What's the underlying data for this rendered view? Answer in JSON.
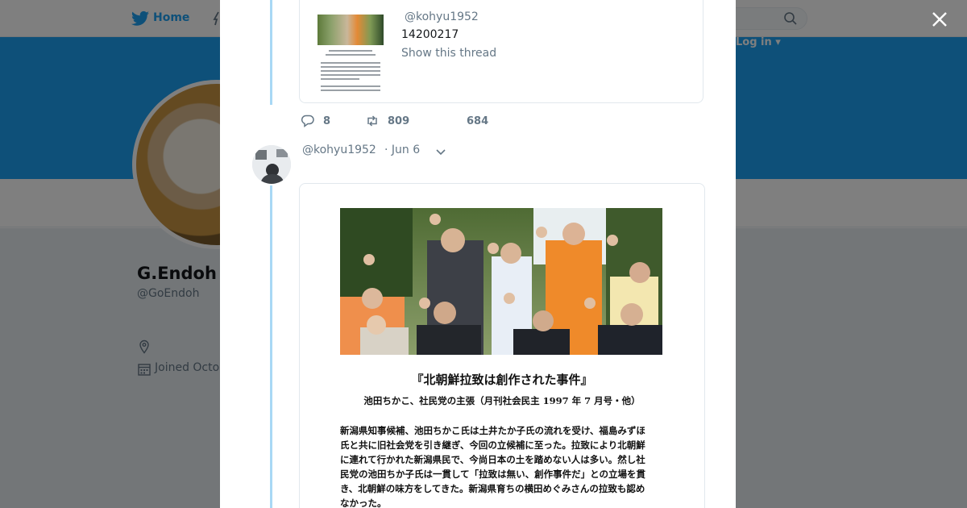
{
  "background": {
    "nav": {
      "home_label": "Home",
      "login_label": "Log in ▾"
    },
    "profile": {
      "name": "G.Endoh",
      "handle": "@GoEndoh",
      "joined": "Joined Octo"
    }
  },
  "quoted_tweet": {
    "handle": "@kohyu1952",
    "text": "14200217",
    "show_thread": "Show this thread"
  },
  "actions": {
    "replies": "8",
    "retweets": "809",
    "likes": "684"
  },
  "tweet": {
    "handle": "@kohyu1952",
    "date": "· Jun 6"
  },
  "document": {
    "title": "『北朝鮮拉致は創作された事件』",
    "subtitle": "池田ちかこ、社民党の主張（月刊社会民主 1997 年 7 月号・他）",
    "body_lines": [
      "新潟県知事候補、池田ちかこ氏は土井たか子氏の流れを受け、福島みずほ",
      "氏と共に旧社会党を引き継ぎ、今回の立候補に至った。拉致により北朝鮮",
      "に連れて行かれた新潟県民で、今尚日本の土を踏めない人は多い。然し社",
      "民党の池田ちか子氏は一貫して「拉致は無い、創作事件だ」との立場を貫",
      "き、北朝鮮の味方をしてきた。新潟県育ちの横田めぐみさんの拉致も認め",
      "なかった。"
    ]
  },
  "colors": {
    "brand": "#1da1f2",
    "thread_line": "#a8d8f5",
    "muted_text": "#657786",
    "overlay": "rgba(0,0,0,0.5)"
  },
  "icons": [
    "twitter-bird-icon",
    "moments-icon",
    "search-icon",
    "close-icon",
    "reply-icon",
    "retweet-icon",
    "like-icon",
    "chevron-down-icon",
    "location-icon",
    "calendar-icon"
  ]
}
